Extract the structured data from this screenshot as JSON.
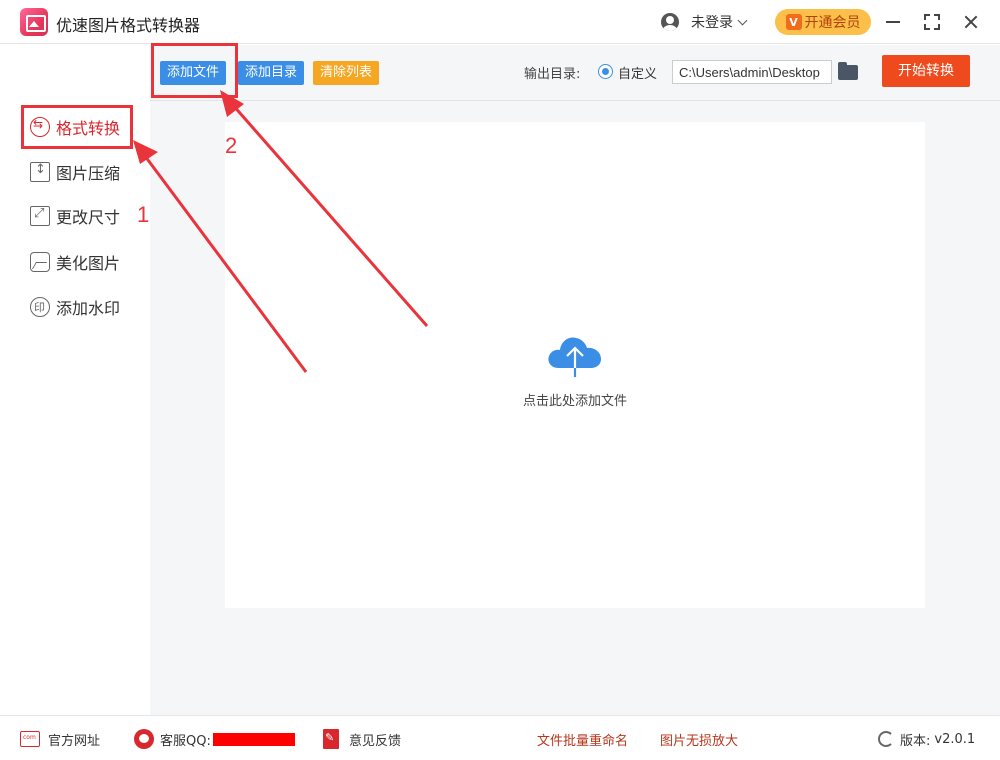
{
  "app": {
    "title": "优速图片格式转换器"
  },
  "header": {
    "user_label": "未登录",
    "vip_label": "开通会员",
    "vip_icon": "V"
  },
  "sidebar": {
    "items": [
      {
        "label": "格式转换",
        "icon": "format-convert-icon",
        "active": true
      },
      {
        "label": "图片压缩",
        "icon": "compress-icon",
        "active": false
      },
      {
        "label": "更改尺寸",
        "icon": "resize-icon",
        "active": false
      },
      {
        "label": "美化图片",
        "icon": "beautify-icon",
        "active": false
      },
      {
        "label": "添加水印",
        "icon": "watermark-icon",
        "active": false
      }
    ]
  },
  "toolbar": {
    "add_file": "添加文件",
    "add_dir": "添加目录",
    "clear_list": "清除列表",
    "output_label": "输出目录:",
    "radio_label": "自定义",
    "output_path": "C:\\Users\\admin\\Desktop",
    "start": "开始转换"
  },
  "dropzone": {
    "text": "点击此处添加文件"
  },
  "footer": {
    "website": "官方网址",
    "qq": "客服QQ:",
    "feedback": "意见反馈",
    "batch_rename": "文件批量重命名",
    "lossless_zoom": "图片无损放大",
    "version_label": "版本:",
    "version": "v2.0.1"
  },
  "annotations": {
    "step1": "1",
    "step2": "2"
  },
  "colors": {
    "accent_blue": "#3a8ee6",
    "start_red": "#ee4a1e",
    "active_red": "#d9272e",
    "annotation_red": "#e8343a"
  }
}
